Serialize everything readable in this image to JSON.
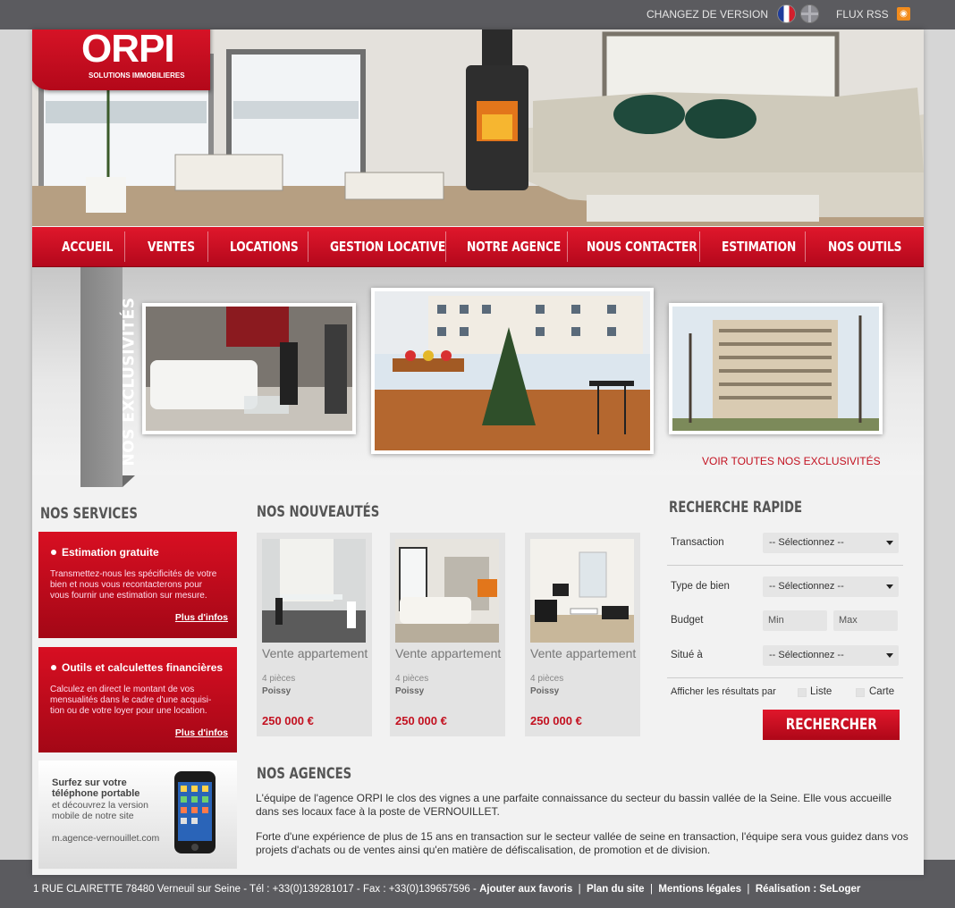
{
  "topbar": {
    "version_label": "CHANGEZ DE VERSION",
    "flux_label": "FLUX RSS",
    "icons": [
      "flag-fr-icon",
      "flag-en-icon",
      "rss-icon"
    ]
  },
  "logo": {
    "name": "ORPI",
    "subtitle": "SOLUTIONS IMMOBILIERES"
  },
  "nav": {
    "items": [
      "ACCUEIL",
      "VENTES",
      "LOCATIONS",
      "GESTION LOCATIVE",
      "NOTRE AGENCE",
      "NOUS CONTACTER",
      "ESTIMATION",
      "NOS OUTILS"
    ]
  },
  "exclusivites": {
    "ribbon": "NOS EXCLUSIVITÉS",
    "link": "VOIR TOUTES NOS EXCLUSIVITÉS"
  },
  "services": {
    "heading": "NOS SERVICES",
    "items": [
      {
        "title": "Estimation gratuite",
        "desc": "Transmettez-nous les spécificités de votre bien et nous vous recontacterons pour vous fournir une estimation sur mesure.",
        "more": "Plus d'infos"
      },
      {
        "title": "Outils et calculettes financières",
        "desc": "Calculez en direct le montant de vos mensualités dans le cadre d'une acquisi-tion ou de votre loyer pour une location.",
        "more": "Plus d'infos"
      }
    ],
    "mobile": {
      "title": "Surfez sur votre téléphone portable",
      "desc": "et découvrez la version mobile de notre site",
      "url": "m.agence-vernouillet.com"
    }
  },
  "nouveautes": {
    "heading": "NOS NOUVEAUTÉS",
    "items": [
      {
        "type": "Vente appartement",
        "rooms": "4 pièces",
        "city": "Poissy",
        "price": "250 000 €"
      },
      {
        "type": "Vente appartement",
        "rooms": "4 pièces",
        "city": "Poissy",
        "price": "250 000 €"
      },
      {
        "type": "Vente appartement",
        "rooms": "4 pièces",
        "city": "Poissy",
        "price": "250 000 €"
      }
    ]
  },
  "recherche": {
    "heading": "RECHERCHE RAPIDE",
    "transaction_label": "Transaction",
    "transaction_value": "-- Sélectionnez --",
    "type_label": "Type de bien",
    "type_value": "-- Sélectionnez --",
    "budget_label": "Budget",
    "min_placeholder": "Min",
    "max_placeholder": "Max",
    "situe_label": "Situé à",
    "situe_value": "-- Sélectionnez --",
    "afficher_label": "Afficher les résultats par",
    "liste_label": "Liste",
    "carte_label": "Carte",
    "button": "RECHERCHER"
  },
  "agences": {
    "heading": "NOS AGENCES",
    "p1": "L'équipe de l'agence ORPI le clos des vignes a une parfaite connaissance du secteur du bassin vallée de la Seine. Elle vous accueille dans ses locaux face à la poste de VERNOUILLET.",
    "p2": "Forte d'une expérience de plus de 15 ans en transaction sur le secteur vallée de seine en transaction, l'équipe sera vous guidez dans vos projets d'achats ou de ventes ainsi qu'en matière de défiscalisation, de promotion et de division."
  },
  "footer": {
    "address": "1 RUE CLAIRETTE 78480 Verneuil sur Seine - Tél : +33(0)139281017 - Fax : +33(0)139657596",
    "links": [
      "Ajouter aux favoris",
      "Plan du site",
      "Mentions légales",
      "Réalisation : SeLoger"
    ]
  }
}
